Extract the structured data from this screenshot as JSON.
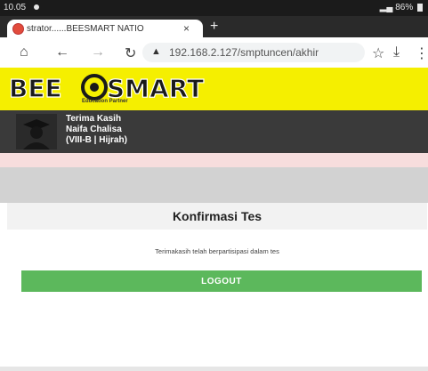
{
  "status_bar": {
    "time": "10.05",
    "battery": "86%"
  },
  "browser": {
    "tab_title": "strator......BEESMART NATIO",
    "tab_close": "×",
    "new_tab": "+",
    "url": "192.168.2.127/smptuncen/akhir",
    "icons": [
      "home-icon",
      "back-icon",
      "forward-icon",
      "reload-icon",
      "star-icon",
      "download-icon",
      "menu-icon"
    ]
  },
  "site": {
    "logo_text": "BEE SMART",
    "logo_subtitle": "Education Partner",
    "colors": {
      "header": "#f5ef00",
      "user_panel": "#3a3a3a",
      "logout": "#5cb85c"
    }
  },
  "user": {
    "greeting": "Terima Kasih",
    "name": "Naifa Chalisa",
    "class": "(VIII-B | Hijrah)"
  },
  "card": {
    "title": "Konfirmasi Tes",
    "message": "Terimakasih telah berpartisipasi dalam tes",
    "logout_label": "LOGOUT"
  }
}
